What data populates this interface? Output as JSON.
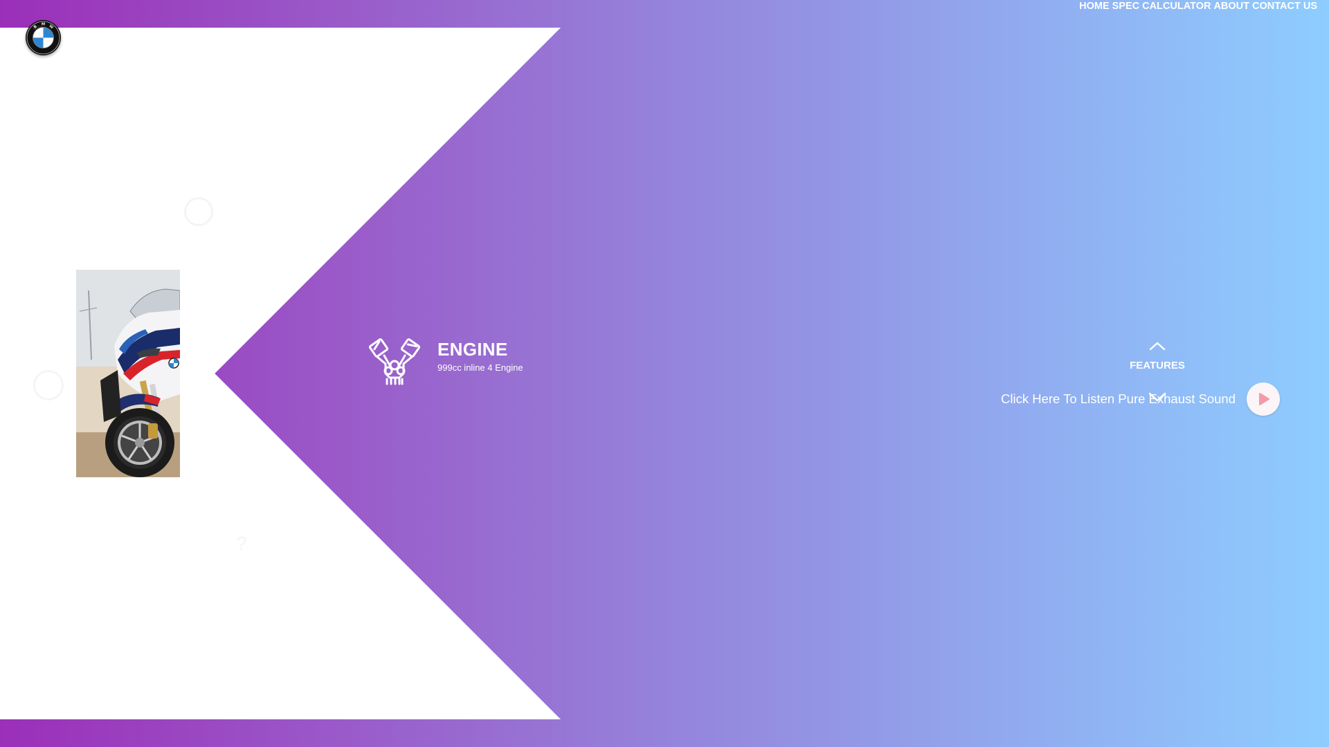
{
  "nav": {
    "items": [
      {
        "label": "HOME"
      },
      {
        "label": "SPEC"
      },
      {
        "label": "CALCULATOR"
      },
      {
        "label": "ABOUT"
      },
      {
        "label": "CONTACT US"
      }
    ]
  },
  "logo": {
    "icon": "bmw-logo-icon",
    "text": "BMW"
  },
  "bike_image": {
    "icon": "motorcycle-image"
  },
  "feature": {
    "icon": "engine-icon",
    "title": "ENGINE",
    "description": "999cc inline 4 Engine"
  },
  "features_nav": {
    "label": "FEATURES",
    "up_icon": "chevron-up-icon",
    "down_icon": "chevron-down-icon"
  },
  "sound": {
    "label": "Click Here To Listen Pure Exhaust Sound",
    "icon": "play-icon"
  },
  "colors": {
    "gradient_start": "#9b2fb9",
    "gradient_end": "#8ecdff",
    "play_icon": "#f39aa8",
    "panel": "#ffffff"
  }
}
